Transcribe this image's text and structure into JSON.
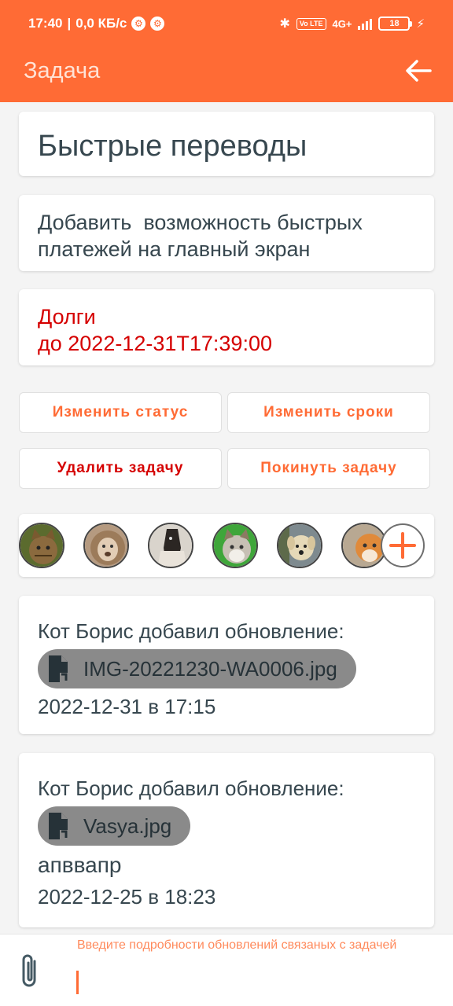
{
  "status_bar": {
    "time": "17:40",
    "speed": "0,0 КБ/с",
    "network": "4G+",
    "volte": "Vo LTE",
    "battery": "18"
  },
  "appbar": {
    "title": "Задача",
    "back_icon": "arrow-left-icon"
  },
  "task": {
    "title": "Быстрые переводы",
    "description": "Добавить  возможность быстрых\nплатежей на главный экран",
    "status_line1": "Долги",
    "status_line2": "до 2022-12-31T17:39:00"
  },
  "actions": {
    "change_status": "Изменить статус",
    "change_deadline": "Изменить сроки",
    "delete_task": "Удалить задачу",
    "leave_task": "Покинуть задачу"
  },
  "members": {
    "avatars": [
      "cat-avatar",
      "lion-avatar",
      "horse-avatar",
      "cat-avatar",
      "dog-avatar",
      "cat-avatar"
    ],
    "add_icon": "plus-icon"
  },
  "updates": [
    {
      "author_line": "Кот Борис добавил обновление:",
      "file": "IMG-20221230-WA0006.jpg",
      "note": "",
      "date": "2022-12-31 в 17:15"
    },
    {
      "author_line": "Кот Борис добавил обновление:",
      "file": "Vasya.jpg",
      "note": "апввапр",
      "date": "2022-12-25 в 18:23"
    }
  ],
  "composer": {
    "placeholder": "Введите подробности обновлений связаных с задачей",
    "attach_icon": "paperclip-icon"
  },
  "colors": {
    "accent": "#ff6b35",
    "danger": "#d50000",
    "text": "#37474f"
  }
}
